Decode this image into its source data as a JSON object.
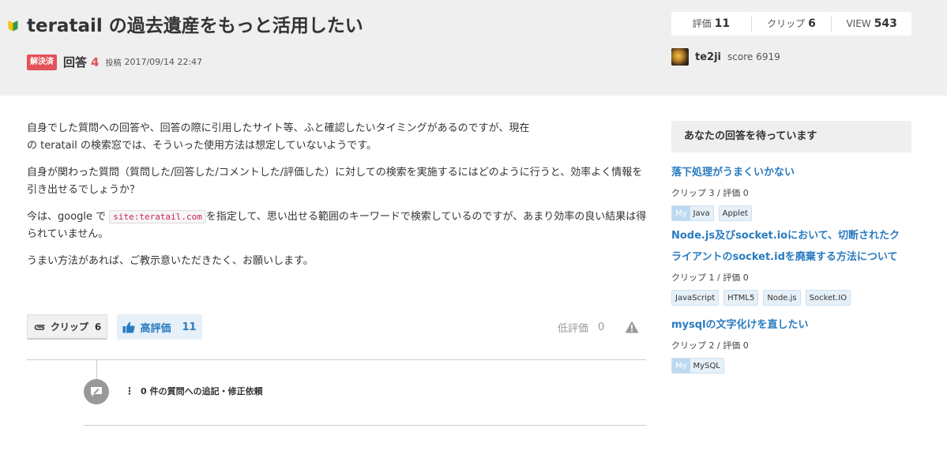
{
  "question": {
    "title": "teratail の過去遺産をもっと活用したい",
    "solved_badge": "解決済",
    "answers_label": "回答",
    "answers_count": "4",
    "posted_label": "投稿",
    "posted_date": "2017/09/14 22:47",
    "body": {
      "p1_line1": "自身でした質問への回答や、回答の際に引用したサイト等、ふと確認したいタイミングがあるのですが、現在",
      "p1_line2": "の teratail の検索窓では、そういった使用方法は想定していないようです。",
      "p2": "自身が関わった質問（質問した/回答した/コメントした/評価した）に対しての検索を実施するにはどのように行うと、効率よく情報を引き出せるでしょうか？",
      "p3_before": "今は、google で",
      "p3_code": "site:teratail.com",
      "p3_after": "を指定して、思い出せる範囲のキーワードで検索しているのですが、あまり効率の良い結果は得られていません。",
      "p4": "うまい方法があれば、ご教示意いただきたく、お願いします。"
    }
  },
  "stats": {
    "rating_label": "評価",
    "rating_value": "11",
    "clip_label": "クリップ",
    "clip_value": "6",
    "view_label": "VIEW",
    "view_value": "543"
  },
  "user": {
    "name": "te2ji",
    "score_label": "score",
    "score_value": "6919"
  },
  "actions": {
    "clip_label": "クリップ",
    "clip_count": "6",
    "upvote_label": "高評価",
    "upvote_count": "11",
    "downvote_label": "低評価",
    "downvote_count": "0"
  },
  "comments": {
    "dots": "⋮",
    "count": "0",
    "label": "件の質問への追記・修正依頼"
  },
  "sidebar": {
    "waiting_title": "あなたの回答を待っています",
    "my_tag_label": "My",
    "recommendations": [
      {
        "title": "落下処理がうまくいかない",
        "meta": "クリップ 3 / 評価 0",
        "tags": [
          {
            "label": "Java",
            "my": true
          },
          {
            "label": "Applet",
            "my": false
          }
        ]
      },
      {
        "title": "Node.js及びsocket.ioにおいて、切断されたクライアントのsocket.idを廃棄する方法について",
        "meta": "クリップ 1 / 評価 0",
        "tags": [
          {
            "label": "JavaScript",
            "my": false
          },
          {
            "label": "HTML5",
            "my": false
          },
          {
            "label": "Node.js",
            "my": false
          },
          {
            "label": "Socket.IO",
            "my": false
          }
        ]
      },
      {
        "title": "mysqlの文字化けを直したい",
        "meta": "クリップ 2 / 評価 0",
        "tags": [
          {
            "label": "MySQL",
            "my": true
          }
        ]
      }
    ]
  },
  "colors": {
    "accent_blue": "#2a7bc0",
    "solved_red": "#e3525a",
    "header_gray": "#efefef"
  },
  "icons": {
    "beginner": "beginner-mark-icon",
    "clip": "paperclip-icon",
    "upvote": "thumbs-up-icon",
    "report": "warning-triangle-icon",
    "comment": "comment-edit-icon"
  }
}
